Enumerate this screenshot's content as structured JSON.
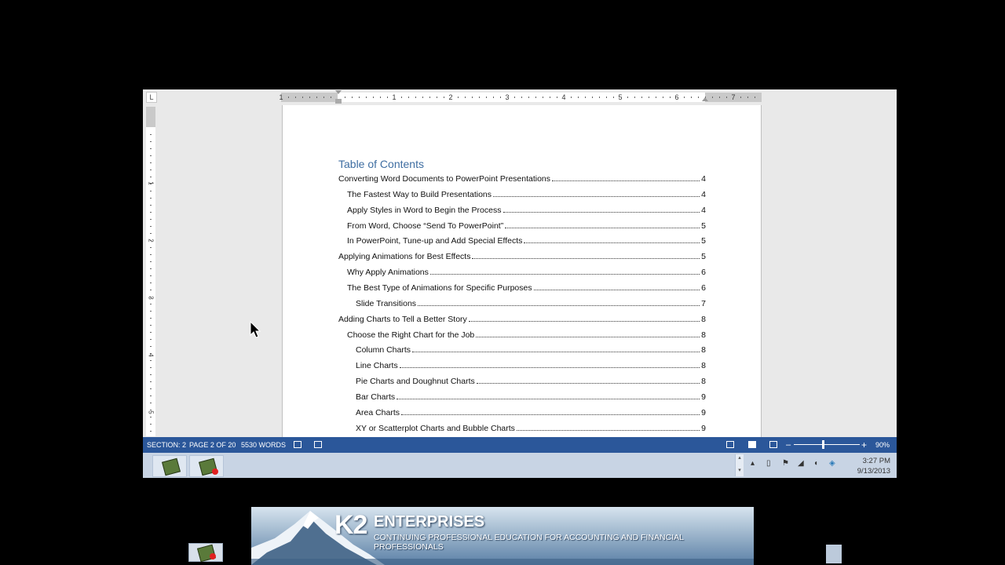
{
  "ruler": {
    "tab_marker": "L",
    "h_numbers": [
      "1",
      "1",
      "2",
      "3",
      "4",
      "5",
      "6",
      "7"
    ],
    "v_numbers": [
      "1",
      "2",
      "3",
      "4",
      "5"
    ]
  },
  "document": {
    "toc_title": "Table of Contents",
    "entries": [
      {
        "text": "Converting Word Documents to PowerPoint Presentations",
        "page": "4",
        "level": 1
      },
      {
        "text": "The Fastest Way to Build Presentations",
        "page": "4",
        "level": 2
      },
      {
        "text": "Apply Styles in Word to Begin the Process",
        "page": "4",
        "level": 2
      },
      {
        "text": "From Word, Choose “Send To PowerPoint”",
        "page": "5",
        "level": 2
      },
      {
        "text": "In PowerPoint, Tune-up and Add Special Effects",
        "page": "5",
        "level": 2
      },
      {
        "text": "Applying Animations for Best Effects",
        "page": "5",
        "level": 1
      },
      {
        "text": "Why Apply Animations",
        "page": "6",
        "level": 2
      },
      {
        "text": "The Best Type of Animations for Specific Purposes",
        "page": "6",
        "level": 2
      },
      {
        "text": "Slide Transitions",
        "page": "7",
        "level": 3
      },
      {
        "text": "Adding Charts to Tell a Better Story",
        "page": "8",
        "level": 1
      },
      {
        "text": "Choose the Right Chart for the Job",
        "page": "8",
        "level": 2
      },
      {
        "text": "Column Charts",
        "page": "8",
        "level": 3
      },
      {
        "text": "Line Charts",
        "page": "8",
        "level": 3
      },
      {
        "text": "Pie Charts and Doughnut Charts",
        "page": "8",
        "level": 3
      },
      {
        "text": "Bar Charts",
        "page": "9",
        "level": 3
      },
      {
        "text": "Area Charts",
        "page": "9",
        "level": 3
      },
      {
        "text": "XY or Scatterplot Charts and Bubble Charts",
        "page": "9",
        "level": 3
      }
    ]
  },
  "status": {
    "section": "SECTION: 2",
    "page": "PAGE 2 OF 20",
    "words": "5530 WORDS",
    "zoom_minus": "–",
    "zoom_plus": "+",
    "zoom": "90%",
    "zoom_level": 0.43
  },
  "taskbar": {
    "time": "3:27 PM",
    "date": "9/13/2013",
    "scroll_up": "▴",
    "scroll_down": "▾",
    "tray_chevron": "▴"
  },
  "banner": {
    "logo": "K2",
    "name": "ENTERPRISES",
    "tagline": "CONTINUING PROFESSIONAL EDUCATION FOR ACCOUNTING AND FINANCIAL PROFESSIONALS"
  },
  "colors": {
    "status_bar": "#2b579a",
    "toc_heading": "#3f6ea2"
  }
}
